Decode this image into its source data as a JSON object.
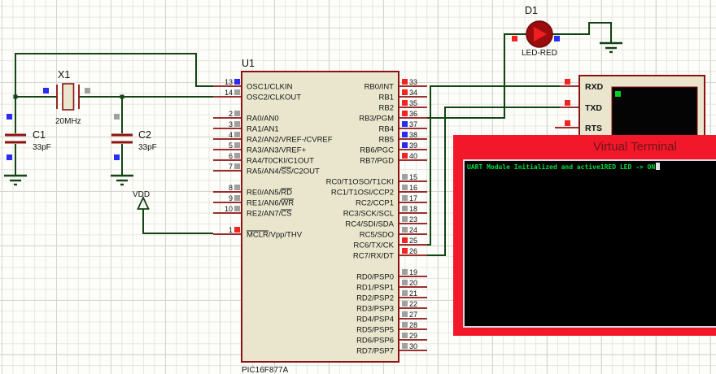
{
  "canvas": {
    "background": "#fdfdfa",
    "grid_minor": "#e7e7e1",
    "grid_major": "#d6d6ce"
  },
  "palette": {
    "wire": "#134413",
    "component_outline": "#8c1212",
    "component_fill": "#e9e6cd",
    "text": "#141414"
  },
  "state_colors": {
    "red": "#f02421",
    "blue": "#2a2cf0",
    "gray": "#a0a0a0"
  },
  "components": {
    "mcu": {
      "ref": "U1",
      "part": "PIC16F877A",
      "left_pin_groups": [
        [
          {
            "n": "13",
            "label": [
              "OSC1/CLKIN"
            ],
            "s": "blue"
          },
          {
            "n": "14",
            "label": [
              "OSC2/CLKOUT"
            ],
            "s": "gray"
          }
        ],
        [
          {
            "n": "2",
            "label": [
              "RA0/AN0"
            ],
            "s": "gray"
          },
          {
            "n": "3",
            "label": [
              "RA1/AN1"
            ],
            "s": "gray"
          },
          {
            "n": "4",
            "label": [
              "RA2/AN2/VREF-/CVREF"
            ],
            "s": "gray"
          },
          {
            "n": "5",
            "label": [
              "RA3/AN3/VREF+"
            ],
            "s": "gray"
          },
          {
            "n": "6",
            "label": [
              "RA4/T0CKI/C1OUT"
            ],
            "s": "gray"
          },
          {
            "n": "7",
            "label": [
              "RA5/AN4/",
              {
                "o": "SS"
              },
              "/C2OUT"
            ],
            "s": "gray"
          }
        ],
        [
          {
            "n": "8",
            "label": [
              "RE0/AN5/",
              {
                "o": "RD"
              }
            ],
            "s": "gray"
          },
          {
            "n": "9",
            "label": [
              "RE1/AN6/",
              {
                "o": "WR"
              }
            ],
            "s": "gray"
          },
          {
            "n": "10",
            "label": [
              "RE2/AN7/",
              {
                "o": "CS"
              }
            ],
            "s": "gray"
          }
        ],
        [
          {
            "n": "1",
            "label": [
              {
                "o": "MCLR"
              },
              "/Vpp/THV"
            ],
            "s": "red"
          }
        ]
      ],
      "right_pin_groups": [
        [
          {
            "n": "33",
            "label": [
              "RB0/INT"
            ],
            "s": "red"
          },
          {
            "n": "34",
            "label": [
              "RB1"
            ],
            "s": "red"
          },
          {
            "n": "35",
            "label": [
              "RB2"
            ],
            "s": "red"
          },
          {
            "n": "36",
            "label": [
              "RB3/PGM"
            ],
            "s": "red"
          },
          {
            "n": "37",
            "label": [
              "RB4"
            ],
            "s": "blue"
          },
          {
            "n": "38",
            "label": [
              "RB5"
            ],
            "s": "blue"
          },
          {
            "n": "39",
            "label": [
              "RB6/PGC"
            ],
            "s": "blue"
          },
          {
            "n": "40",
            "label": [
              "RB7/PGD"
            ],
            "s": "red"
          }
        ],
        [
          {
            "n": "15",
            "label": [
              "RC0/T1OSO/T1CKI"
            ],
            "s": "gray"
          },
          {
            "n": "16",
            "label": [
              "RC1/T1OSI/CCP2"
            ],
            "s": "gray"
          },
          {
            "n": "17",
            "label": [
              "RC2/CCP1"
            ],
            "s": "gray"
          },
          {
            "n": "18",
            "label": [
              "RC3/SCK/SCL"
            ],
            "s": "gray"
          },
          {
            "n": "23",
            "label": [
              "RC4/SDI/SDA"
            ],
            "s": "gray"
          },
          {
            "n": "24",
            "label": [
              "RC5/SDO"
            ],
            "s": "gray"
          },
          {
            "n": "25",
            "label": [
              "RC6/TX/CK"
            ],
            "s": "red"
          },
          {
            "n": "26",
            "label": [
              "RC7/RX/DT"
            ],
            "s": "red"
          }
        ],
        [
          {
            "n": "19",
            "label": [
              "RD0/PSP0"
            ],
            "s": "gray"
          },
          {
            "n": "20",
            "label": [
              "RD1/PSP1"
            ],
            "s": "gray"
          },
          {
            "n": "21",
            "label": [
              "RD2/PSP2"
            ],
            "s": "gray"
          },
          {
            "n": "22",
            "label": [
              "RD3/PSP3"
            ],
            "s": "gray"
          },
          {
            "n": "27",
            "label": [
              "RD4/PSP4"
            ],
            "s": "gray"
          },
          {
            "n": "28",
            "label": [
              "RD5/PSP5"
            ],
            "s": "gray"
          },
          {
            "n": "29",
            "label": [
              "RD6/PSP6"
            ],
            "s": "gray"
          },
          {
            "n": "30",
            "label": [
              "RD7/PSP7"
            ],
            "s": "gray"
          }
        ]
      ]
    },
    "crystal": {
      "ref": "X1",
      "value": "20MHz"
    },
    "c1": {
      "ref": "C1",
      "value": "33pF"
    },
    "c2": {
      "ref": "C2",
      "value": "33pF"
    },
    "led": {
      "ref": "D1",
      "part": "LED-RED",
      "body_color": "#9b0d0d",
      "arrow_color": "#f01f1f"
    },
    "vterm_component": {
      "pins": [
        "RXD",
        "TXD",
        "RTS"
      ],
      "cursor_color": "#00cf28"
    },
    "power_flag": {
      "label": "VDD"
    }
  },
  "popup": {
    "title": "Virtual Terminal",
    "output_line": "UART Module Initialized and active1RED LED -> ON",
    "bar_color": "#f2182a",
    "text_color": "#00df3c"
  }
}
